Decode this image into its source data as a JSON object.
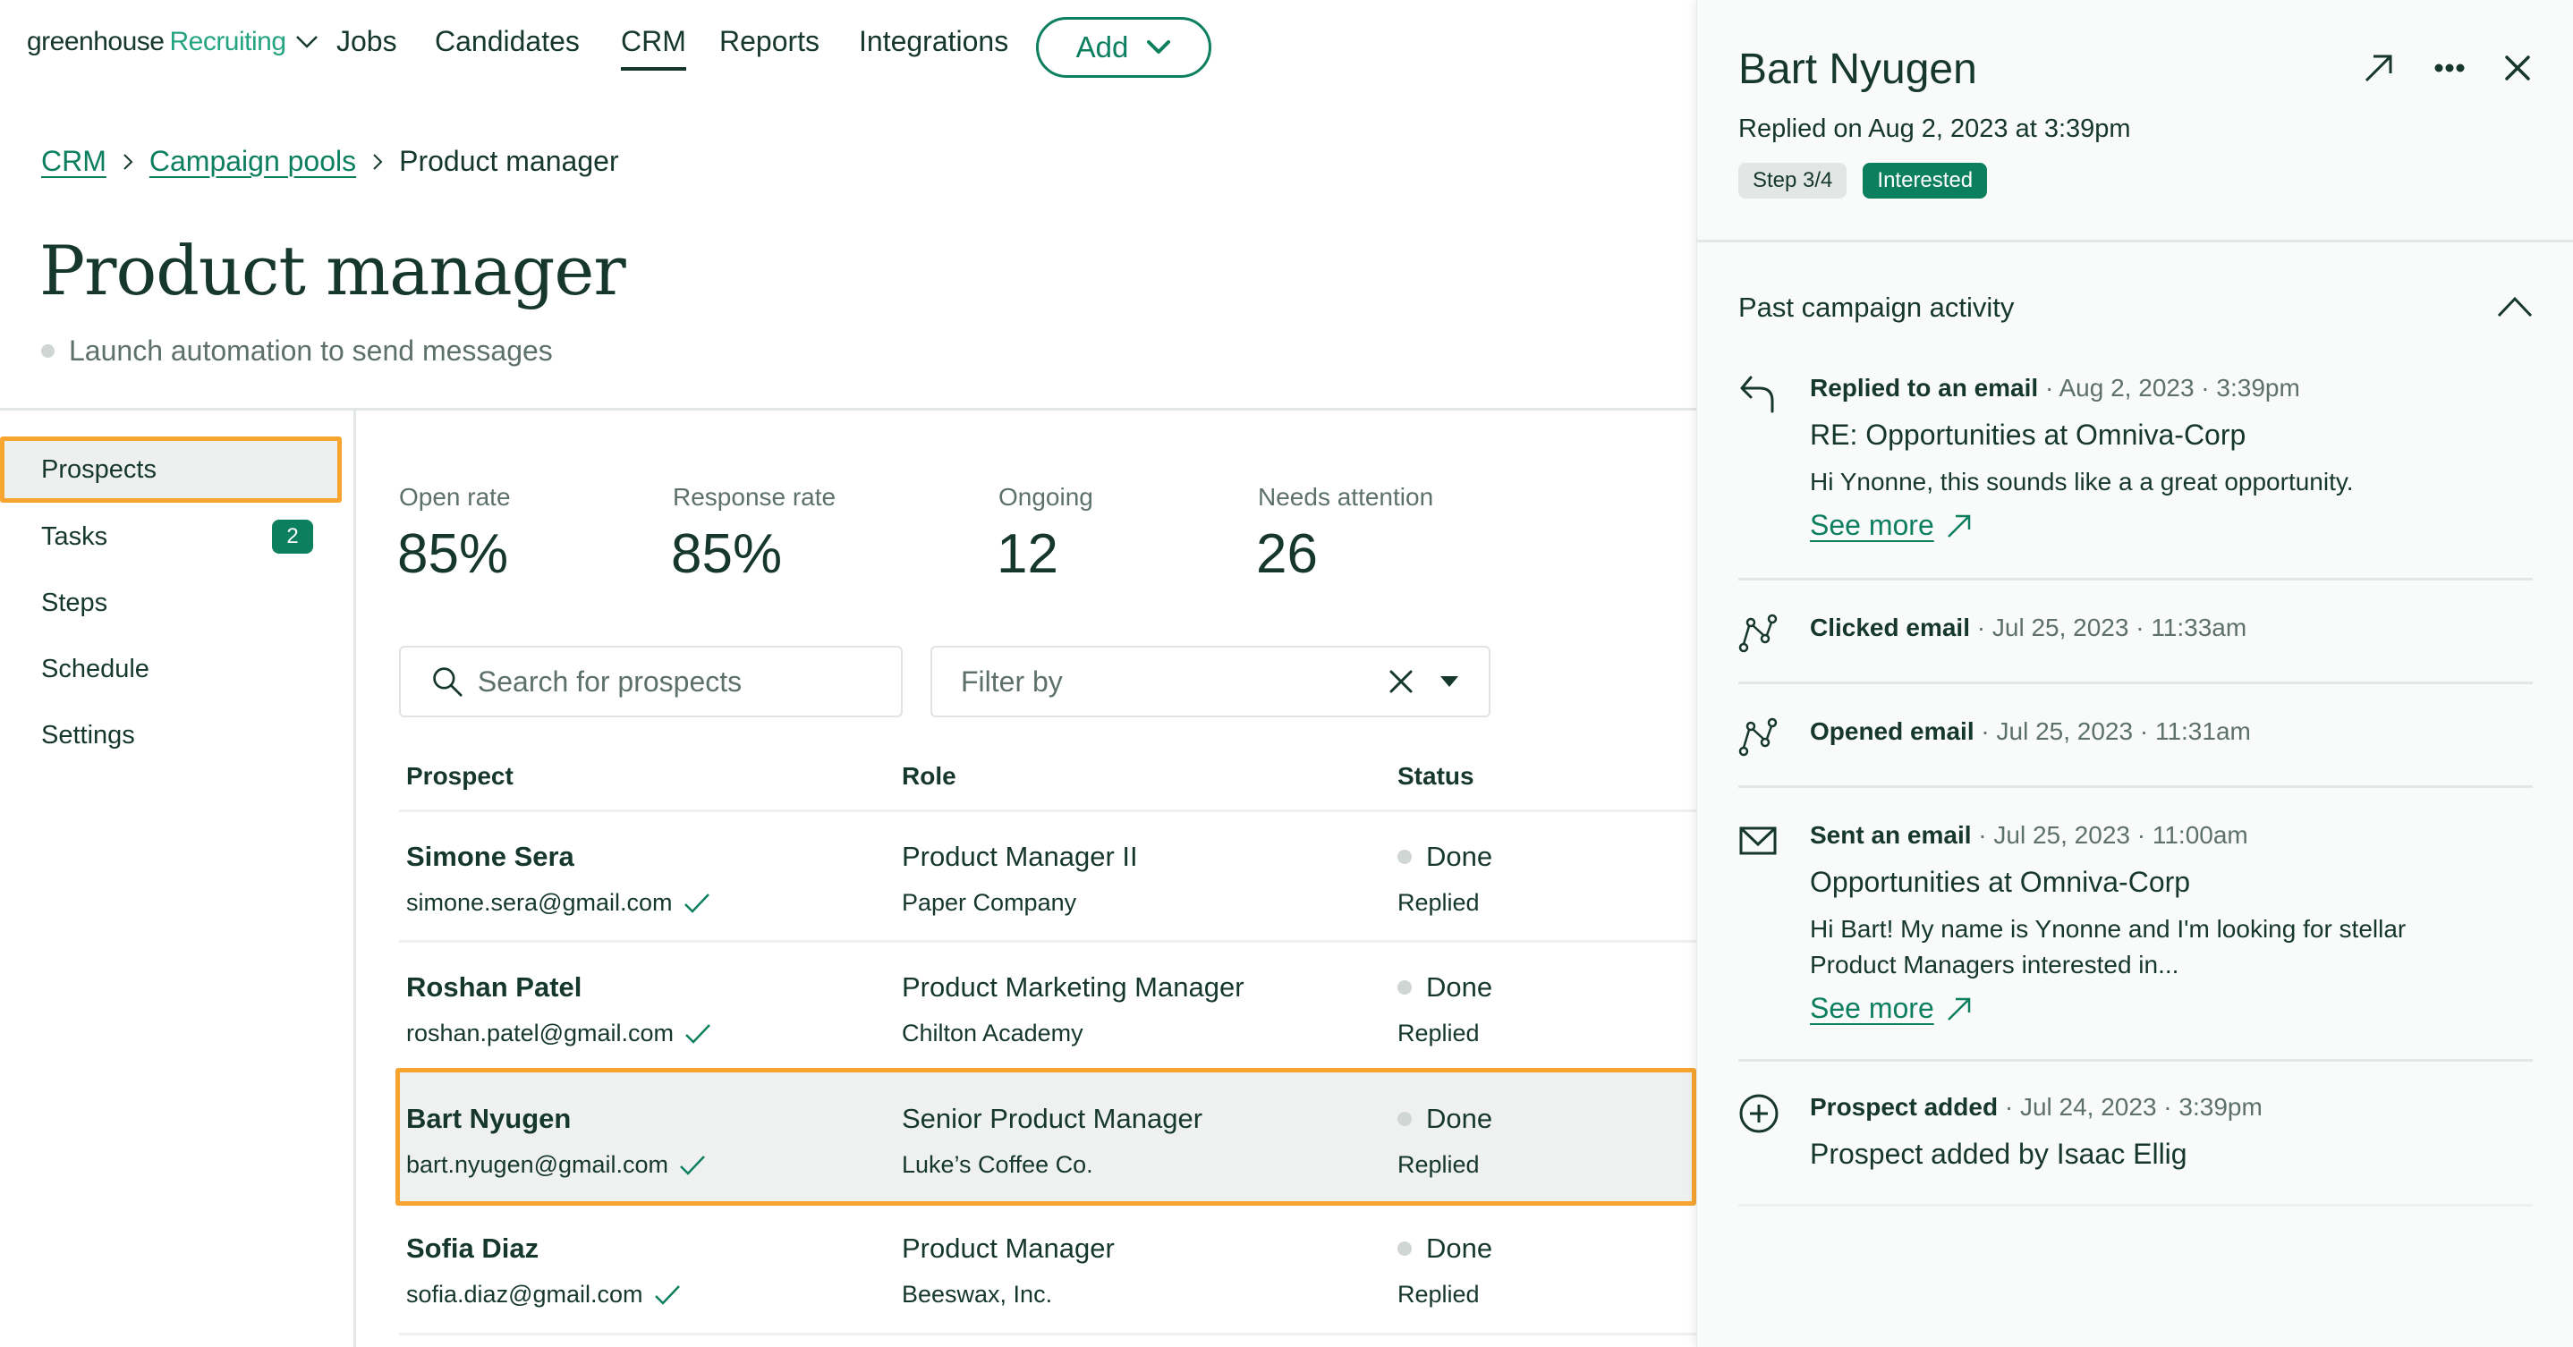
{
  "nav": {
    "logo_primary": "greenhouse",
    "logo_secondary": "Recruiting",
    "links": [
      {
        "label": "Jobs",
        "active": false
      },
      {
        "label": "Candidates",
        "active": false
      },
      {
        "label": "CRM",
        "active": true
      },
      {
        "label": "Reports",
        "active": false
      },
      {
        "label": "Integrations",
        "active": false
      }
    ],
    "add_label": "Add"
  },
  "breadcrumb": {
    "items": [
      "CRM",
      "Campaign pools"
    ],
    "current": "Product manager"
  },
  "page": {
    "title": "Product manager",
    "subtitle": "Launch automation to send messages"
  },
  "sidebar": {
    "items": [
      {
        "label": "Prospects",
        "active": true
      },
      {
        "label": "Tasks",
        "badge": "2"
      },
      {
        "label": "Steps"
      },
      {
        "label": "Schedule"
      },
      {
        "label": "Settings"
      }
    ]
  },
  "stats": [
    {
      "label": "Open rate",
      "value": "85%"
    },
    {
      "label": "Response rate",
      "value": "85%"
    },
    {
      "label": "Ongoing",
      "value": "12"
    },
    {
      "label": "Needs attention",
      "value": "26"
    }
  ],
  "search": {
    "placeholder": "Search for prospects",
    "value": ""
  },
  "filter": {
    "placeholder": "Filter by"
  },
  "table": {
    "columns": [
      "Prospect",
      "Role",
      "Status"
    ],
    "rows": [
      {
        "name": "Simone Sera",
        "email": "simone.sera@gmail.com",
        "role": "Product Manager II",
        "company": "Paper Company",
        "status": "Done",
        "substatus": "Replied",
        "selected": false
      },
      {
        "name": "Roshan Patel",
        "email": "roshan.patel@gmail.com",
        "role": "Product Marketing Manager",
        "company": "Chilton Academy",
        "status": "Done",
        "substatus": "Replied",
        "selected": false
      },
      {
        "name": "Bart Nyugen",
        "email": "bart.nyugen@gmail.com",
        "role": "Senior Product Manager",
        "company": "Luke’s Coffee Co.",
        "status": "Done",
        "substatus": "Replied",
        "selected": true
      },
      {
        "name": "Sofia Diaz",
        "email": "sofia.diaz@gmail.com",
        "role": "Product Manager",
        "company": "Beeswax, Inc.",
        "status": "Done",
        "substatus": "Replied",
        "selected": false
      }
    ]
  },
  "panel": {
    "name": "Bart Nyugen",
    "replied": "Replied on Aug 2, 2023 at 3:39pm",
    "step_badge": "Step 3/4",
    "status_badge": "Interested",
    "section_title": "Past campaign activity",
    "activities": [
      {
        "icon": "reply-icon",
        "title": "Replied to an email",
        "meta": " · Aug 2, 2023 · 3:39pm",
        "subject": "RE: Opportunities at Omniva-Corp",
        "text": "Hi Ynonne, this sounds like a a great opportunity.",
        "link": "See more"
      },
      {
        "icon": "route-icon",
        "title": "Clicked email",
        "meta": " · Jul 25, 2023 · 11:33am"
      },
      {
        "icon": "route-icon",
        "title": "Opened email",
        "meta": " · Jul 25, 2023 · 11:31am"
      },
      {
        "icon": "mail-icon",
        "title": "Sent an email",
        "meta": " · Jul 25, 2023 · 11:00am",
        "subject": "Opportunities at Omniva-Corp",
        "text": "Hi Bart! My name is Ynonne and I'm looking for stellar Product Managers interested in...",
        "link": "See more"
      },
      {
        "icon": "plus-circle-icon",
        "title": "Prospect added",
        "meta": " · Jul 24, 2023 · 3:39pm",
        "subject": "Prospect added by Isaac Ellig"
      }
    ]
  },
  "colors": {
    "brand_dark": "#15372c",
    "brand_green": "#0c7f5e",
    "brand_light_green": "#24a47f",
    "highlight": "#f7a530",
    "muted": "#5d7169"
  }
}
